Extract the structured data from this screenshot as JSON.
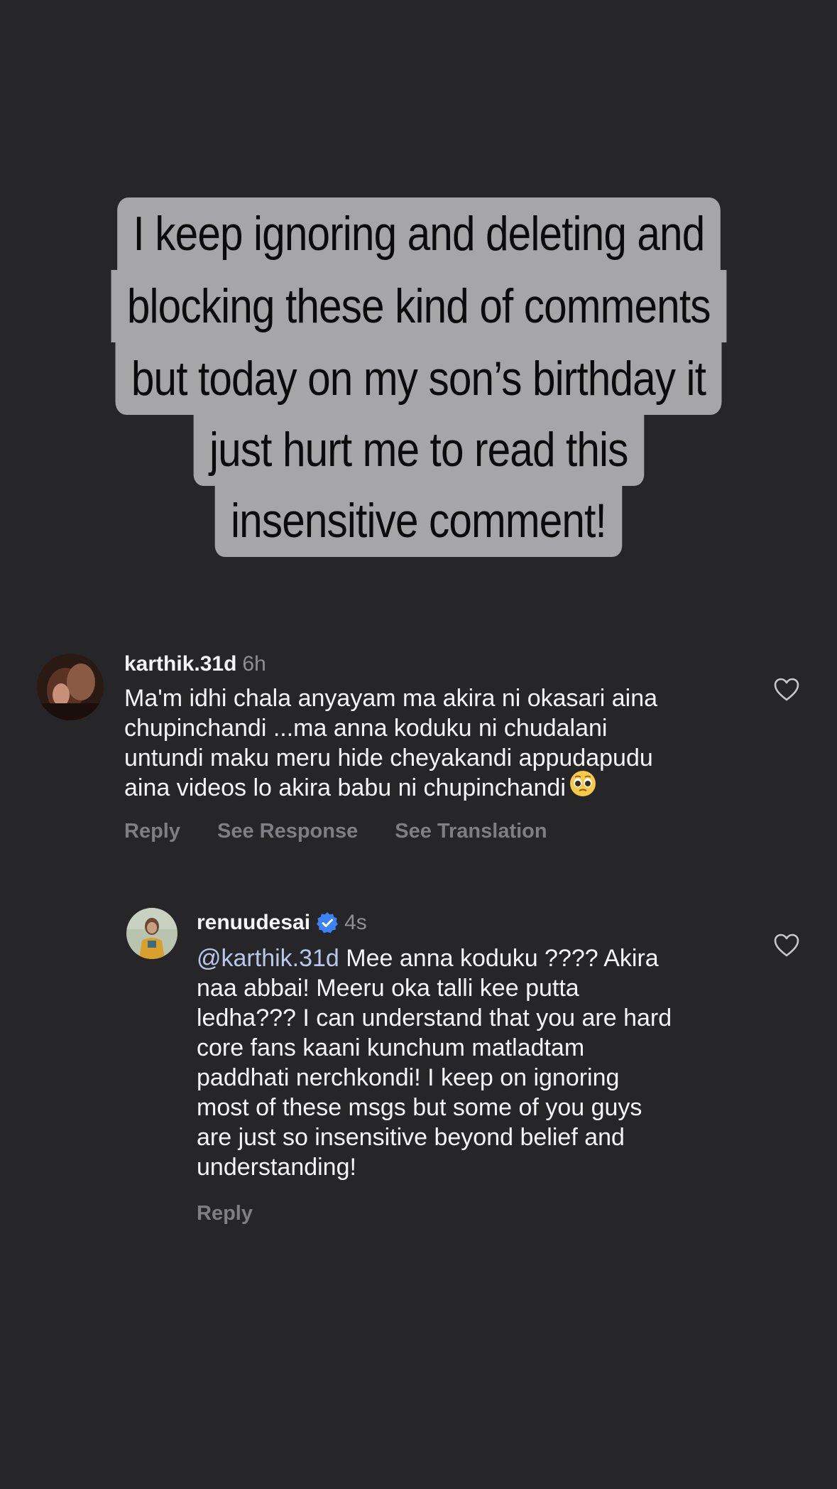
{
  "caption": {
    "lines": [
      "I keep ignoring and deleting and",
      "blocking these kind of comments",
      "but today on my son’s birthday it",
      "just hurt me to read this",
      "insensitive comment!"
    ]
  },
  "comments": [
    {
      "username": "karthik.31d",
      "time": "6h",
      "text": "Ma'm idhi chala anyayam ma akira ni okasari aina chupinchandi ...ma anna koduku ni chudalani untundi maku meru hide cheyakandi appudapudu aina videos lo akira babu ni chupinchandi",
      "text_lines": [
        "Ma'm idhi chala anyayam ma akira ni okasari aina",
        "chupinchandi ...ma anna koduku ni chudalani",
        "untundi maku meru hide cheyakandi appudapudu",
        "aina videos lo akira babu ni chupinchandi"
      ],
      "emoji": "pleading-face-emoji",
      "actions": [
        "Reply",
        "See Response",
        "See Translation"
      ],
      "like_icon": "heart-outline-icon"
    },
    {
      "username": "renuudesai",
      "verified": true,
      "time": "4s",
      "mention": "@karthik.31d",
      "text_lines": [
        "Mee anna koduku ???? Akira",
        "naa abbai! Meeru oka talli kee putta",
        "ledha??? I can understand that you are hard",
        "core fans kaani kunchum matladtam",
        "paddhati nerchkondi! I keep on ignoring",
        "most of these msgs but some of you guys",
        "are just so insensitive beyond belief and",
        "understanding!"
      ],
      "actions": [
        "Reply"
      ],
      "like_icon": "heart-outline-icon"
    }
  ],
  "colors": {
    "background": "#262628",
    "caption_bg": "#a6a6a8",
    "text_primary": "#f5f5f5",
    "text_secondary": "#8e8e93",
    "verified_blue": "#3b82f6"
  }
}
